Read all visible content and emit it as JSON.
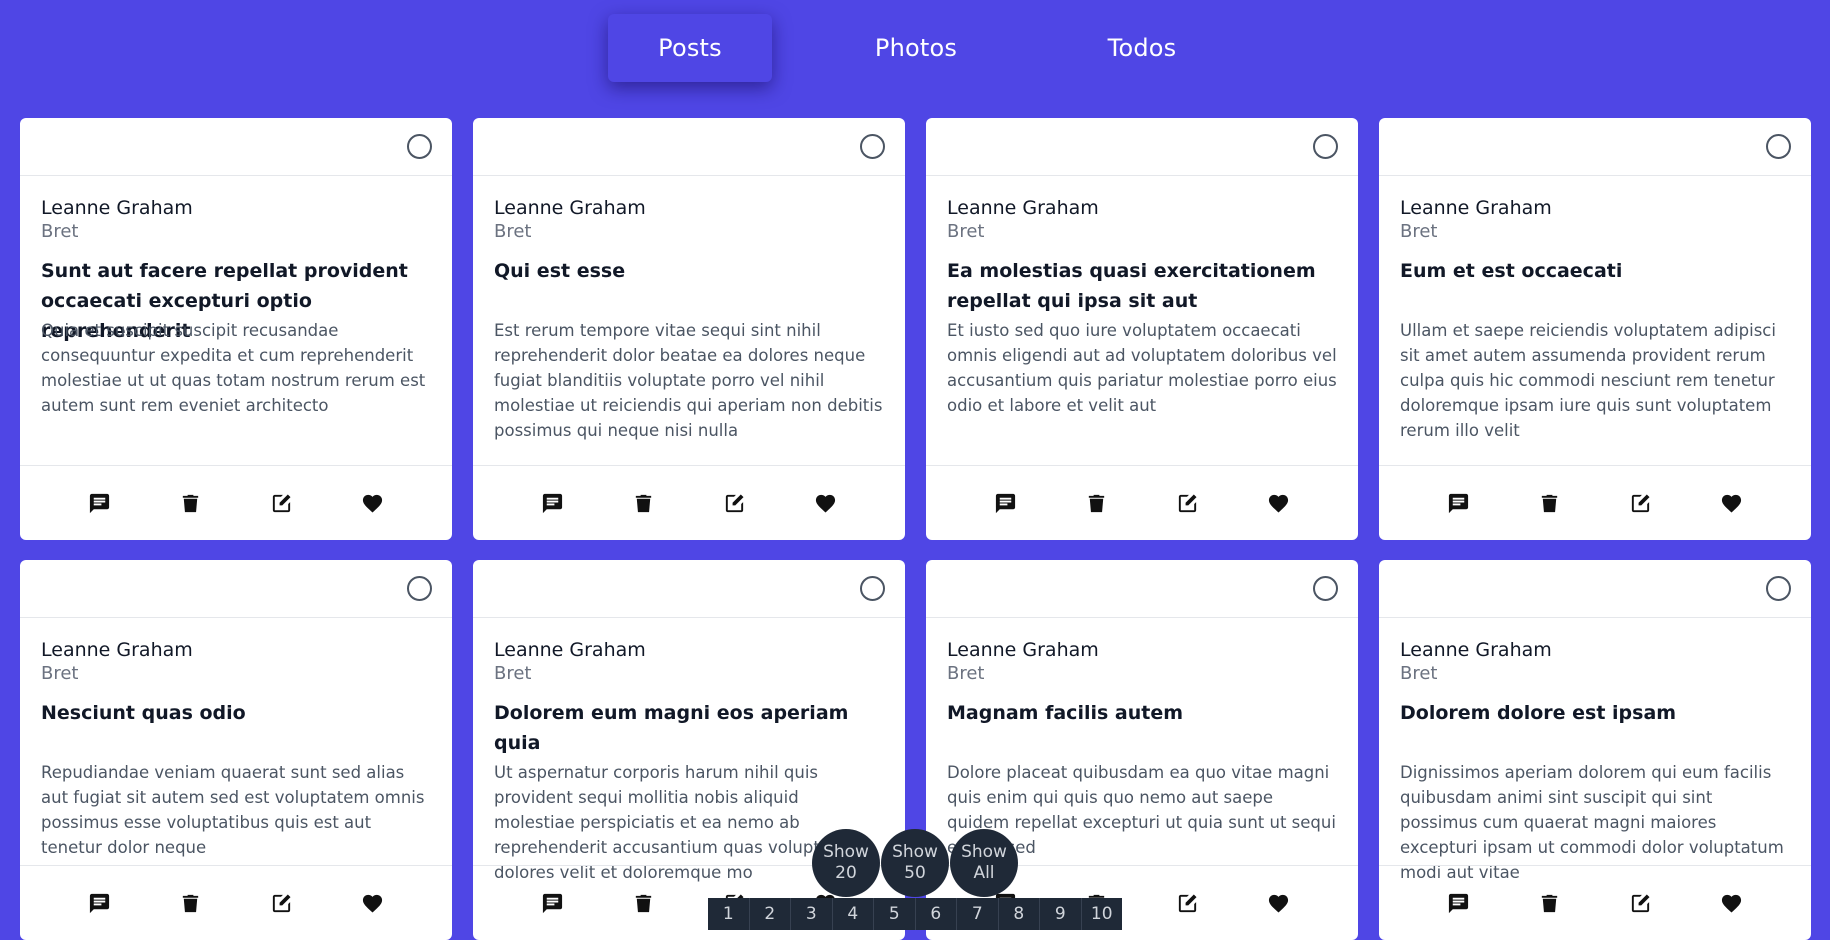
{
  "nav": {
    "tabs": [
      "Posts",
      "Photos",
      "Todos"
    ],
    "active": "Posts"
  },
  "posts": [
    {
      "author": "Leanne Graham",
      "username": "Bret",
      "title": "Sunt aut facere repellat provident occaecati excepturi optio reprehenderit",
      "body": "Quia et suscipit suscipit recusandae consequuntur expedita et cum reprehenderit molestiae ut ut quas totam nostrum rerum est autem sunt rem eveniet architecto"
    },
    {
      "author": "Leanne Graham",
      "username": "Bret",
      "title": "Qui est esse",
      "body": "Est rerum tempore vitae sequi sint nihil reprehenderit dolor beatae ea dolores neque fugiat blanditiis voluptate porro vel nihil molestiae ut reiciendis qui aperiam non debitis possimus qui neque nisi nulla"
    },
    {
      "author": "Leanne Graham",
      "username": "Bret",
      "title": "Ea molestias quasi exercitationem repellat qui ipsa sit aut",
      "body": "Et iusto sed quo iure voluptatem occaecati omnis eligendi aut ad voluptatem doloribus vel accusantium quis pariatur molestiae porro eius odio et labore et velit aut"
    },
    {
      "author": "Leanne Graham",
      "username": "Bret",
      "title": "Eum et est occaecati",
      "body": "Ullam et saepe reiciendis voluptatem adipisci sit amet autem assumenda provident rerum culpa quis hic commodi nesciunt rem tenetur doloremque ipsam iure quis sunt voluptatem rerum illo velit"
    },
    {
      "author": "Leanne Graham",
      "username": "Bret",
      "title": "Nesciunt quas odio",
      "body": "Repudiandae veniam quaerat sunt sed alias aut fugiat sit autem sed est voluptatem omnis possimus esse voluptatibus quis est aut tenetur dolor neque"
    },
    {
      "author": "Leanne Graham",
      "username": "Bret",
      "title": "Dolorem eum magni eos aperiam quia",
      "body": "Ut aspernatur corporis harum nihil quis provident sequi mollitia nobis aliquid molestiae perspiciatis et ea nemo ab reprehenderit accusantium quas voluptate dolores velit et doloremque mo"
    },
    {
      "author": "Leanne Graham",
      "username": "Bret",
      "title": "Magnam facilis autem",
      "body": "Dolore placeat quibusdam ea quo vitae magni quis enim qui quis quo nemo aut saepe quidem repellat excepturi ut quia sunt ut sequi eos ea sed"
    },
    {
      "author": "Leanne Graham",
      "username": "Bret",
      "title": "Dolorem dolore est ipsam",
      "body": "Dignissimos aperiam dolorem qui eum facilis quibusdam animi sint suscipit qui sint possimus cum quaerat magni maiores excepturi ipsam ut commodi dolor voluptatum modi aut vitae"
    }
  ],
  "card_actions": [
    "comment-icon",
    "trash-icon",
    "edit-icon",
    "heart-icon"
  ],
  "show_buttons": [
    {
      "line1": "Show",
      "line2": "20"
    },
    {
      "line1": "Show",
      "line2": "50"
    },
    {
      "line1": "Show",
      "line2": "All"
    }
  ],
  "pagination": [
    "1",
    "2",
    "3",
    "4",
    "5",
    "6",
    "7",
    "8",
    "9",
    "10"
  ]
}
